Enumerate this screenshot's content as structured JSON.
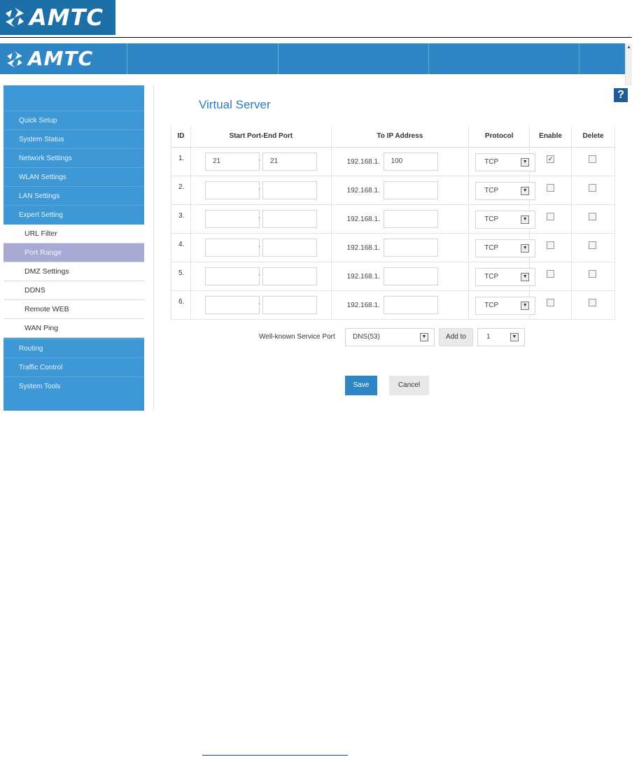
{
  "document": {
    "logo_text": "AMTC"
  },
  "app": {
    "logo_text": "AMTC",
    "help_label": "?"
  },
  "sidebar": {
    "items": [
      {
        "label": "Quick Setup"
      },
      {
        "label": "System Status"
      },
      {
        "label": "Network Settings"
      },
      {
        "label": "WLAN Settings"
      },
      {
        "label": "LAN Settings"
      },
      {
        "label": "Expert Setting"
      }
    ],
    "sub_items": [
      {
        "label": "URL Filter"
      },
      {
        "label": "Port Range",
        "active": true
      },
      {
        "label": "DMZ Settings"
      },
      {
        "label": "DDNS"
      },
      {
        "label": "Remote WEB"
      },
      {
        "label": "WAN Ping"
      }
    ],
    "items_after": [
      {
        "label": "Routing"
      },
      {
        "label": "Traffic Control"
      },
      {
        "label": "System Tools"
      }
    ]
  },
  "page": {
    "title": "Virtual Server"
  },
  "table": {
    "headers": [
      "ID",
      "Start Port-End Port",
      "To IP Address",
      "Protocol",
      "Enable",
      "Delete"
    ],
    "ip_prefix": "192.168.1.",
    "rows": [
      {
        "id": "1.",
        "start": "21",
        "end": "21",
        "ip": "100",
        "protocol": "TCP",
        "enabled": true,
        "delete": false
      },
      {
        "id": "2.",
        "start": "",
        "end": "",
        "ip": "",
        "protocol": "TCP",
        "enabled": false,
        "delete": false
      },
      {
        "id": "3.",
        "start": "",
        "end": "",
        "ip": "",
        "protocol": "TCP",
        "enabled": false,
        "delete": false
      },
      {
        "id": "4.",
        "start": "",
        "end": "",
        "ip": "",
        "protocol": "TCP",
        "enabled": false,
        "delete": false
      },
      {
        "id": "5.",
        "start": "",
        "end": "",
        "ip": "",
        "protocol": "TCP",
        "enabled": false,
        "delete": false
      },
      {
        "id": "6.",
        "start": "",
        "end": "",
        "ip": "",
        "protocol": "TCP",
        "enabled": false,
        "delete": false
      }
    ]
  },
  "service": {
    "label": "Well-known Service Port",
    "selected": "DNS(53)",
    "add_label": "Add to",
    "add_target": "1"
  },
  "actions": {
    "save_label": "Save",
    "cancel_label": "Cancel"
  },
  "colors": {
    "brand_blue": "#2f86c4",
    "sidebar_blue": "#3d98d5",
    "active_item": "#a9a9d6",
    "title_blue": "#2b7bc0"
  }
}
